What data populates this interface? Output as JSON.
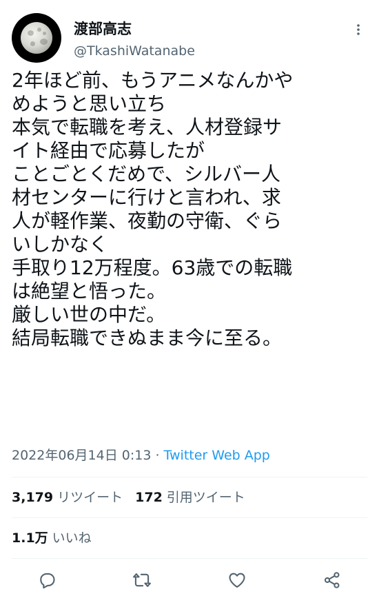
{
  "user": {
    "display_name": "渡部高志",
    "handle": "@TkashiWatanabe"
  },
  "tweet": {
    "lines": [
      "2年ほど前、もうアニメなんかや",
      "めようと思い立ち",
      "本気で転職を考え、人材登録サ",
      "イト経由で応募したが",
      "ことごとくだめで、シルバー人",
      "材センターに行けと言われ、求",
      "人が軽作業、夜勤の守衛、ぐら",
      "いしかなく",
      "手取り12万程度。63歳での転職",
      "は絶望と悟った。",
      "厳しい世の中だ。",
      "結局転職できぬまま今に至る。"
    ]
  },
  "meta": {
    "datetime": "2022年06月14日 0:13",
    "separator": " · ",
    "source": "Twitter Web App"
  },
  "stats": {
    "retweets_count": "3,179",
    "retweets_label": "リツイート",
    "quotes_count": "172",
    "quotes_label": "引用ツイート",
    "likes_count": "1.1万",
    "likes_label": "いいね"
  },
  "icons": {
    "more": "more-vertical-icon",
    "reply": "reply-icon",
    "retweet": "retweet-icon",
    "like": "heart-icon",
    "share": "share-icon"
  },
  "colors": {
    "text": "#0f1419",
    "secondary": "#536471",
    "link": "#1d9bf0",
    "divider": "#eff3f4"
  }
}
